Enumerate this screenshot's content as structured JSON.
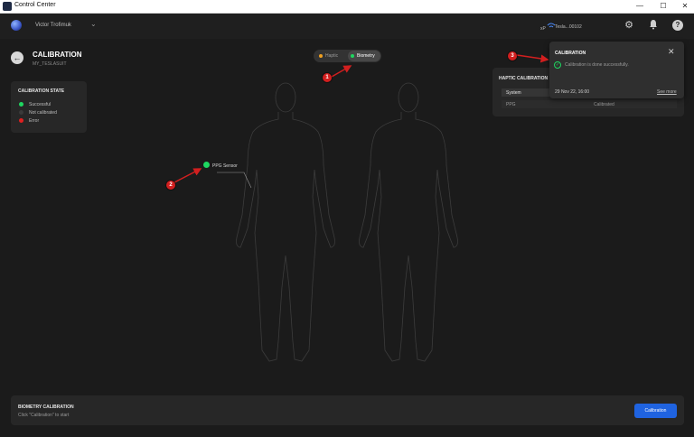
{
  "window": {
    "title": "Control Center",
    "minimize": "—",
    "maximize": "☐",
    "close": "✕"
  },
  "header": {
    "user_name": "Victor Trofimuk",
    "user_menu_icon": "chevron-down-icon",
    "device_status": "Tesla...00102",
    "icons": [
      "gear-icon",
      "bell-icon",
      "help-icon"
    ]
  },
  "page": {
    "title": "CALIBRATION",
    "subtitle": "MY_TESLASUIT",
    "back_icon": "arrow-left-icon"
  },
  "mode_toggle": {
    "options": [
      {
        "label": "Haptic",
        "color": "#f0a020",
        "active": false
      },
      {
        "label": "Biometry",
        "color": "#1ed760",
        "active": true
      }
    ]
  },
  "calibration_state": {
    "title": "CALIBRATION STATE",
    "items": [
      {
        "label": "Successful",
        "color": "#1ed760"
      },
      {
        "label": "Not calibrated",
        "color": "#3a3a3a"
      },
      {
        "label": "Error",
        "color": "#e02020"
      }
    ]
  },
  "sensor": {
    "label": "PPG Sensor",
    "color": "#1ed760"
  },
  "haptic_calibration": {
    "title": "HAPTIC CALIBRATION",
    "rows": [
      {
        "name": "System",
        "status": ""
      },
      {
        "name": "PPG",
        "status": "Calibrated"
      }
    ]
  },
  "notification": {
    "title": "CALIBRATION",
    "message": "Calibration is done successfully.",
    "date": "29 Nov 22, 16:00",
    "link": "See more"
  },
  "annotations": [
    "1",
    "2",
    "3"
  ],
  "bottom": {
    "title": "BIOMETRY CALIBRATION",
    "subtitle": "Click \"Calibration\" to start",
    "button": "Calibration"
  }
}
